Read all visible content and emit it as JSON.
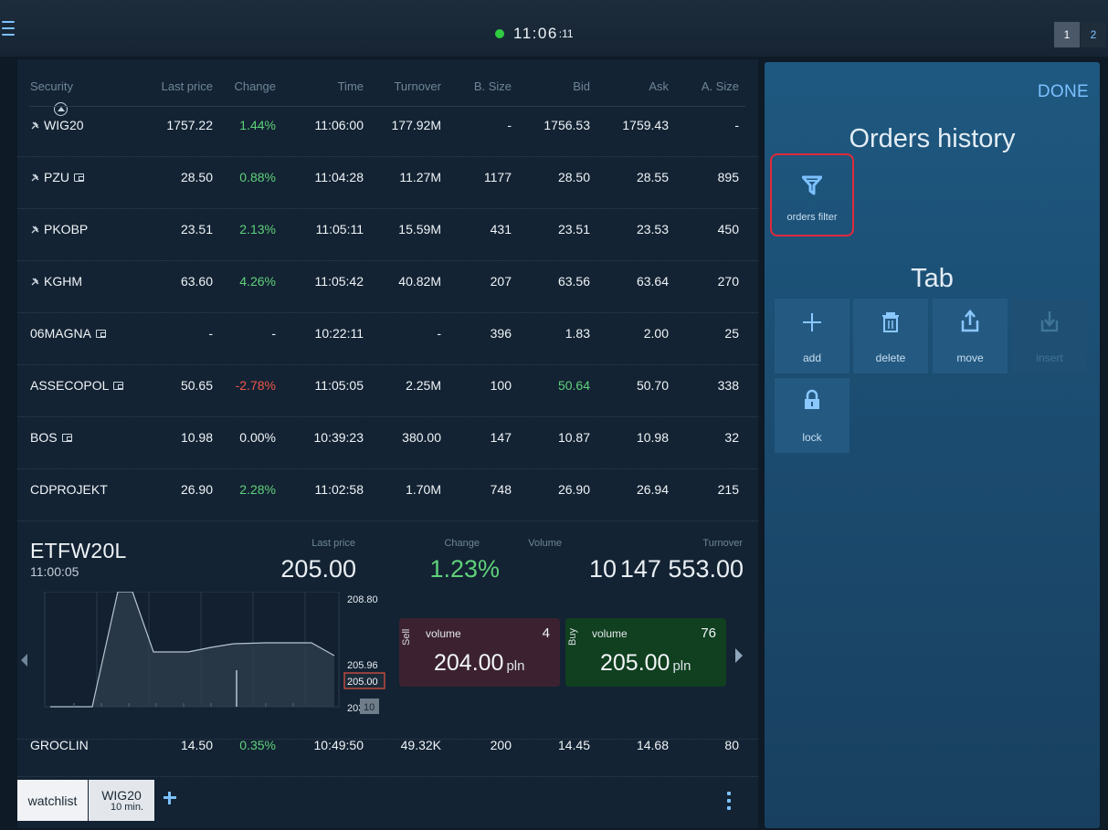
{
  "topbar": {
    "clock_main": "11:06",
    "clock_sec": ":11",
    "status_color": "#2ecc40",
    "page_buttons": [
      "1",
      "2"
    ]
  },
  "table": {
    "columns": [
      "Security",
      "Last price",
      "Change",
      "Time",
      "Turnover",
      "B. Size",
      "Bid",
      "Ask",
      "A. Size"
    ],
    "rows": [
      {
        "security": "WIG20",
        "pin": true,
        "wallet": false,
        "last": "1757.22",
        "change": "1.44%",
        "dir": "pos",
        "time": "11:06:00",
        "turnover": "177.92M",
        "bsize": "-",
        "bid": "1756.53",
        "bid_dir": "",
        "ask": "1759.43",
        "asize": "-"
      },
      {
        "security": "PZU",
        "pin": true,
        "wallet": true,
        "last": "28.50",
        "change": "0.88%",
        "dir": "pos",
        "time": "11:04:28",
        "turnover": "11.27M",
        "bsize": "1177",
        "bid": "28.50",
        "bid_dir": "",
        "ask": "28.55",
        "asize": "895"
      },
      {
        "security": "PKOBP",
        "pin": true,
        "wallet": false,
        "last": "23.51",
        "change": "2.13%",
        "dir": "pos",
        "time": "11:05:11",
        "turnover": "15.59M",
        "bsize": "431",
        "bid": "23.51",
        "bid_dir": "",
        "ask": "23.53",
        "asize": "450"
      },
      {
        "security": "KGHM",
        "pin": true,
        "wallet": false,
        "last": "63.60",
        "change": "4.26%",
        "dir": "pos",
        "time": "11:05:42",
        "turnover": "40.82M",
        "bsize": "207",
        "bid": "63.56",
        "bid_dir": "",
        "ask": "63.64",
        "asize": "270"
      },
      {
        "security": "06MAGNA",
        "pin": false,
        "wallet": true,
        "last": "-",
        "change": "-",
        "dir": "",
        "time": "10:22:11",
        "turnover": "-",
        "bsize": "396",
        "bid": "1.83",
        "bid_dir": "",
        "ask": "2.00",
        "asize": "25"
      },
      {
        "security": "ASSECOPOL",
        "pin": false,
        "wallet": true,
        "last": "50.65",
        "change": "-2.78%",
        "dir": "neg",
        "time": "11:05:05",
        "turnover": "2.25M",
        "bsize": "100",
        "bid": "50.64",
        "bid_dir": "pos",
        "ask": "50.70",
        "asize": "338"
      },
      {
        "security": "BOS",
        "pin": false,
        "wallet": true,
        "last": "10.98",
        "change": "0.00%",
        "dir": "",
        "time": "10:39:23",
        "turnover": "380.00",
        "bsize": "147",
        "bid": "10.87",
        "bid_dir": "",
        "ask": "10.98",
        "asize": "32"
      },
      {
        "security": "CDPROJEKT",
        "pin": false,
        "wallet": false,
        "last": "26.90",
        "change": "2.28%",
        "dir": "pos",
        "time": "11:02:58",
        "turnover": "1.70M",
        "bsize": "748",
        "bid": "26.90",
        "bid_dir": "",
        "ask": "26.94",
        "asize": "215"
      }
    ],
    "after_rows": [
      {
        "security": "GROCLIN",
        "pin": false,
        "wallet": false,
        "last": "14.50",
        "change": "0.35%",
        "dir": "pos",
        "time": "10:49:50",
        "turnover": "49.32K",
        "bsize": "200",
        "bid": "14.45",
        "bid_dir": "",
        "ask": "14.68",
        "asize": "80"
      }
    ]
  },
  "expanded": {
    "name": "ETFW20L",
    "time": "11:00:05",
    "last_price_label": "Last price",
    "last_price": "205.00",
    "change_label": "Change",
    "change": "1.23%",
    "volume_label": "Volume",
    "volume": "10",
    "turnover_label": "Turnover",
    "turnover": "147 553.00",
    "axis_top": "208.80",
    "axis_mid": "205.96",
    "axis_current": "205.00",
    "axis_bottom": "203",
    "axis_volume": "10",
    "sell": {
      "side": "Sell",
      "volume_label": "volume",
      "volume": "4",
      "price": "204.00",
      "currency": "pln"
    },
    "buy": {
      "side": "Buy",
      "volume_label": "volume",
      "volume": "76",
      "price": "205.00",
      "currency": "pln"
    }
  },
  "tabs": {
    "watchlist": "watchlist",
    "wig_line1": "WIG20",
    "wig_line2": "10 min."
  },
  "panel": {
    "done": "DONE",
    "title": "Orders history",
    "filter_label": "orders filter",
    "tab_title": "Tab",
    "buttons": [
      "add",
      "delete",
      "move",
      "insert",
      "lock"
    ]
  },
  "colors": {
    "accent": "#7cc1ff",
    "positive": "#5fd17a",
    "negative": "#f0554a",
    "highlight_border": "#e02a3a"
  }
}
